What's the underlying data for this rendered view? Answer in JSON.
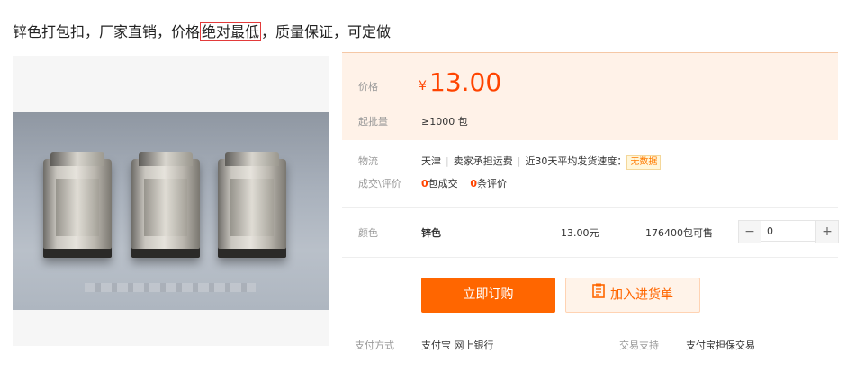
{
  "title": {
    "before": "锌色打包扣，厂家直销，价格",
    "highlight": "绝对最低",
    "after": "，质量保证，可定做"
  },
  "price": {
    "label": "价格",
    "symbol": "¥",
    "value": "13.00",
    "moq_label": "起批量",
    "moq_value": "≥1000 包"
  },
  "logistics": {
    "label": "物流",
    "origin": "天津",
    "freight": "卖家承担运费",
    "speed_label": "近30天平均发货速度：",
    "speed_value": "无数据",
    "deal_label": "成交\\评价",
    "deals_count": "0",
    "deals_text": "包成交",
    "reviews_count": "0",
    "reviews_text": "条评价"
  },
  "sku": {
    "label": "颜色",
    "name": "锌色",
    "price": "13.00元",
    "stock": "176400包可售",
    "minus": "−",
    "quantity": "0",
    "plus": "+"
  },
  "actions": {
    "order": "立即订购",
    "cart": "加入进货单"
  },
  "payment": {
    "label": "支付方式",
    "value": "支付宝  网上银行",
    "trade_label": "交易支持",
    "trade_value": "支付宝担保交易"
  },
  "colors": {
    "accent": "#ff6600",
    "price": "#ff4400",
    "highlight_border": "#e23a3a"
  },
  "icons": [
    "document-cart-icon",
    "minus-icon",
    "plus-icon"
  ]
}
